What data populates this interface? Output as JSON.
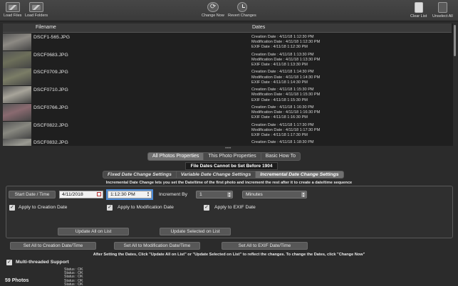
{
  "toolbar": {
    "load_files": "Load Files",
    "load_folders": "Load Folders",
    "change_now": "Change Now",
    "revert_changes": "Revert Changes",
    "clear_list": "Clear List",
    "unselect_all": "Unselect All"
  },
  "list": {
    "col_filename": "Filename",
    "col_dates": "Dates",
    "rows": [
      {
        "name": "DSCF1-565.JPG",
        "creation": "Creation Date : 4/11/18 1:12:30 PM",
        "modification": "Modification Date : 4/11/18 1:12:30 PM",
        "exif": "EXIF Date : 4/11/18 1:12:30 PM",
        "thumb_color": "#8d8a84"
      },
      {
        "name": "DSCF0683.JPG",
        "creation": "Creation Date : 4/11/18 1:13:30 PM",
        "modification": "Modification Date : 4/11/18 1:13:30 PM",
        "exif": "EXIF Date : 4/11/18 1:13:30 PM",
        "thumb_color": "#6d6f5a"
      },
      {
        "name": "DSCF0709.JPG",
        "creation": "Creation Date : 4/11/18 1:14:30 PM",
        "modification": "Modification Date : 4/11/18 1:14:30 PM",
        "exif": "EXIF Date : 4/11/18 1:14:30 PM",
        "thumb_color": "#7b7d66"
      },
      {
        "name": "DSCF0710.JPG",
        "creation": "Creation Date : 4/11/18 1:15:30 PM",
        "modification": "Modification Date : 4/11/18 1:15:30 PM",
        "exif": "EXIF Date : 4/11/18 1:15:30 PM",
        "thumb_color": "#a7a49a"
      },
      {
        "name": "DSCF0766.JPG",
        "creation": "Creation Date : 4/11/18 1:16:30 PM",
        "modification": "Modification Date : 4/11/18 1:16:30 PM",
        "exif": "EXIF Date : 4/11/18 1:16:30 PM",
        "thumb_color": "#8a6a70"
      },
      {
        "name": "DSCF0822.JPG",
        "creation": "Creation Date : 4/11/18 1:17:30 PM",
        "modification": "Modification Date : 4/11/18 1:17:30 PM",
        "exif": "EXIF Date : 4/11/18 1:17:30 PM",
        "thumb_color": "#888880"
      },
      {
        "name": "DSCF0832.JPG",
        "creation": "Creation Date : 4/11/18 1:18:30 PM",
        "modification": "",
        "exif": "",
        "thumb_color": "#9a9a92"
      }
    ]
  },
  "tabs": {
    "top": [
      "All Photos Properties",
      "This Photo Properties",
      "Basic How To"
    ],
    "top_active": 0,
    "sub": [
      "Fixed Date Change Settings",
      "Variable Date Change Settings",
      "Incremental Date Change Settings"
    ],
    "sub_active": 2
  },
  "warning": "File Dates Cannot be Set Before 1904",
  "incremental_note": "Incremental Date Change lets you set the Date/time of the first photo and increment the rest after it to create a date/time sequence",
  "settings": {
    "start_button": "Start Date / Time",
    "date_value": "4/11/2018",
    "time_value": "1:12:30 PM",
    "increment_label": "Increment By",
    "increment_value": "1",
    "unit_value": "Minutes",
    "apply_creation": "Apply to Creation Date",
    "apply_modification": "Apply to Modification Date",
    "apply_exif": "Apply to EXIF Date",
    "update_all": "Update All on List",
    "update_selected": "Update Selected on List",
    "checkmark": "✓"
  },
  "set_buttons": {
    "creation": "Set All to Creation Date/Time",
    "modification": "Set All to Modification Date/Time",
    "exif": "Set All to EXIF Date/Time"
  },
  "after_note": "After Setting the Dates, Click \"Update All on List\" or \"Update Selected on List\" to reflect the changes. To change the Dates, click \"Change Now\"",
  "multithread": "Multi-threaded Support",
  "status": [
    "Status : OK",
    "Status : OK",
    "Status : OK",
    "Status : OK",
    "Status : OK"
  ],
  "photo_count": "59 Photos"
}
